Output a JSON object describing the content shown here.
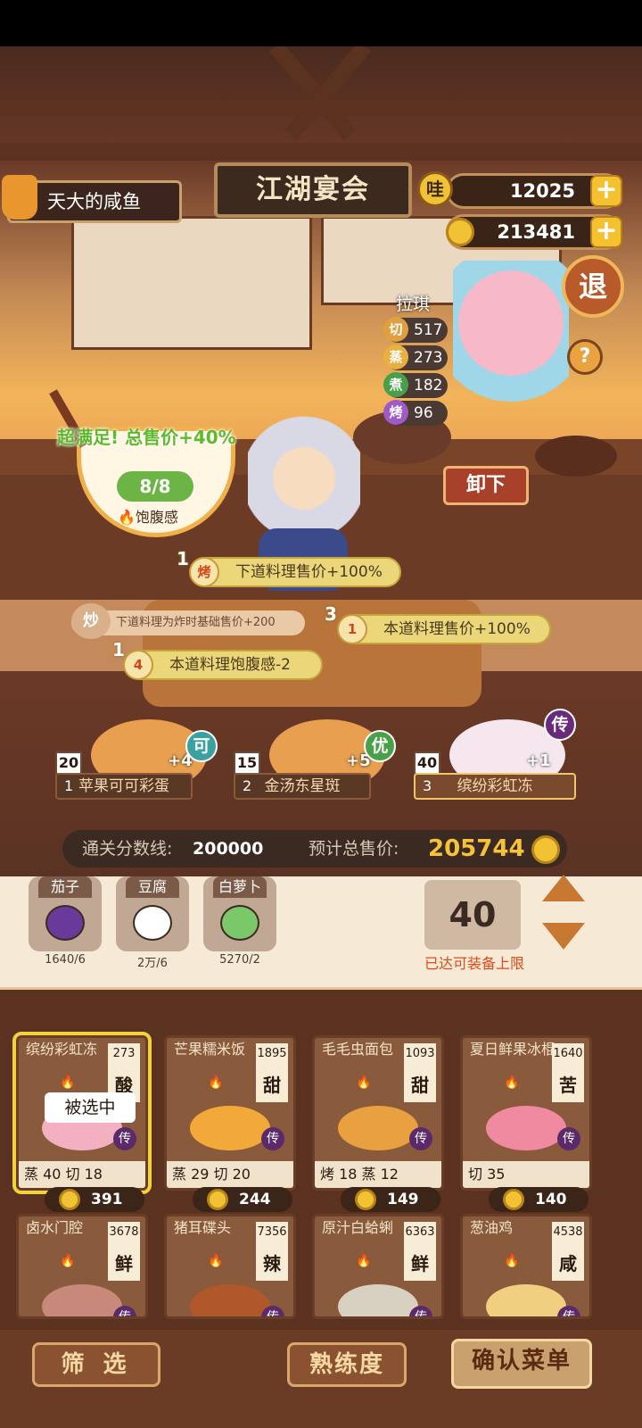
{
  "header": {
    "sign": "江湖宴会",
    "player_name": "天大的咸鱼",
    "currency_1": "12025",
    "currency_1_icon": "哇",
    "currency_2": "213481",
    "exit_label": "退",
    "help_label": "?"
  },
  "chef": {
    "name": "拉琪",
    "stats": [
      {
        "icon": "切",
        "value": "517",
        "color": "#e0a040"
      },
      {
        "icon": "蒸",
        "value": "273",
        "color": "#e8b040"
      },
      {
        "icon": "煮",
        "value": "182",
        "color": "#4aa04a"
      },
      {
        "icon": "烤",
        "value": "96",
        "color": "#a05ac8"
      }
    ],
    "unload_label": "卸下"
  },
  "satiety": {
    "bonus_text": "超满足! 总售价+40%",
    "value": "8/8",
    "label": "饱腹感"
  },
  "buffs": [
    {
      "num": "1",
      "icon": "烤",
      "text": "下道料理售价+100%"
    },
    {
      "num": "3",
      "icon": "1",
      "text": "本道料理售价+100%"
    },
    {
      "num": "1",
      "icon": "4",
      "text": "本道料理饱腹感-2"
    }
  ],
  "stir_buff": {
    "icon": "炒",
    "text": "下道料理为炸时基础售价+200"
  },
  "menu_slots": [
    {
      "index": "1",
      "name": "苹果可可彩蛋",
      "qty": "20",
      "bonus": "+4",
      "rarity": "可",
      "rarity_color": "#3aa0a0"
    },
    {
      "index": "2",
      "name": "金汤东星斑",
      "qty": "15",
      "bonus": "+5",
      "rarity": "优",
      "rarity_color": "#4aa04a"
    },
    {
      "index": "3",
      "name": "缤纷彩虹冻",
      "qty": "40",
      "bonus": "+1",
      "rarity": "传",
      "rarity_color": "#6a2a7a"
    }
  ],
  "score": {
    "pass_label": "通关分数线:",
    "pass_value": "200000",
    "total_label": "预计总售价:",
    "total_value": "205744"
  },
  "ingredients": [
    {
      "name": "茄子",
      "count": "1640/6",
      "color": "#6a3a9a"
    },
    {
      "name": "豆腐",
      "count": "2万/6",
      "color": "#ffffff"
    },
    {
      "name": "白萝卜",
      "count": "5270/2",
      "color": "#7ac86a"
    }
  ],
  "capacity": {
    "value": "40",
    "text": "已达可装备上限"
  },
  "dishes": [
    {
      "name": "缤纷彩虹冻",
      "price": "273",
      "taste": "酸",
      "stats": "蒸 40  切 18",
      "coins": "391",
      "selected": true,
      "food": "#f3b0c0"
    },
    {
      "name": "芒果糯米饭",
      "price": "1895",
      "taste": "甜",
      "stats": "蒸 29  切 20",
      "coins": "244",
      "selected": false,
      "food": "#f2a93a"
    },
    {
      "name": "毛毛虫面包",
      "price": "1093",
      "taste": "甜",
      "stats": "烤 18  蒸 12",
      "coins": "149",
      "selected": false,
      "food": "#e9a040"
    },
    {
      "name": "夏日鲜果冰棍",
      "price": "1640",
      "taste": "苦",
      "stats": "切 35",
      "coins": "140",
      "selected": false,
      "food": "#f08aa0"
    },
    {
      "name": "卤水门腔",
      "price": "3678",
      "taste": "鲜",
      "food": "#c78a7a"
    },
    {
      "name": "猪耳碟头",
      "price": "7356",
      "taste": "辣",
      "food": "#b0582a"
    },
    {
      "name": "原汁白蛤蜊",
      "price": "6363",
      "taste": "鲜",
      "food": "#d8d0c0"
    },
    {
      "name": "葱油鸡",
      "price": "4538",
      "taste": "咸",
      "food": "#f0d080"
    }
  ],
  "selected_label": "被选中",
  "legend_label": "传",
  "footer": {
    "filter": "筛 选",
    "proficiency": "熟练度",
    "confirm": "确认菜单"
  }
}
